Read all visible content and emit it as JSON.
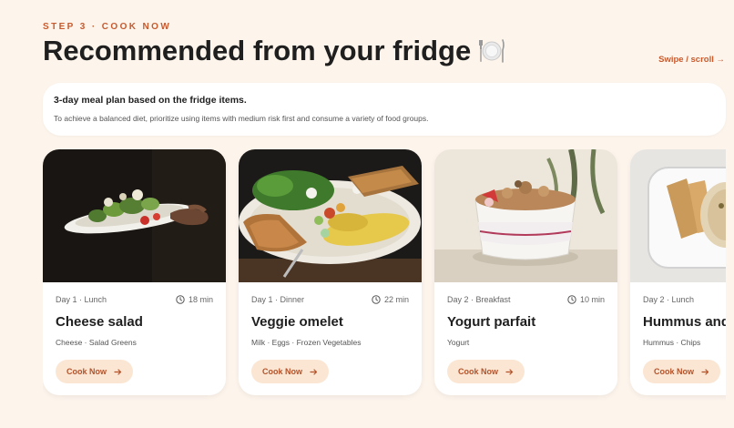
{
  "header": {
    "step": "STEP 3 · COOK NOW",
    "title": "Recommended from your fridge",
    "swipe_hint": "Swipe / scroll →"
  },
  "info": {
    "title": "3-day meal plan based on the fridge items.",
    "text": "To achieve a balanced diet, prioritize using items with medium risk first and consume a variety of food groups."
  },
  "cards": [
    {
      "day": "Day 1 · Lunch",
      "time": "18 min",
      "name": "Cheese salad",
      "ingredients": "Cheese · Salad Greens",
      "button": "Cook Now"
    },
    {
      "day": "Day 1 · Dinner",
      "time": "22 min",
      "name": "Veggie omelet",
      "ingredients": "Milk · Eggs · Frozen Vegetables",
      "button": "Cook Now"
    },
    {
      "day": "Day 2 · Breakfast",
      "time": "10 min",
      "name": "Yogurt parfait",
      "ingredients": "Yogurt",
      "button": "Cook Now"
    },
    {
      "day": "Day 2 · Lunch",
      "time": "",
      "name": "Hummus and",
      "ingredients": "Hummus · Chips",
      "button": "Cook Now"
    }
  ],
  "colors": {
    "background": "#fdf5ec",
    "accent": "#c85a2e",
    "button_bg": "#fbe6d3",
    "button_text": "#b4532a"
  },
  "icons": [
    "plate-cutlery-icon",
    "clock-icon",
    "arrow-right-icon"
  ]
}
